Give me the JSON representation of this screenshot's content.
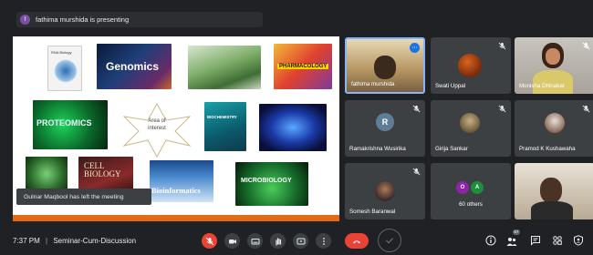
{
  "banner": {
    "avatar_letter": "f",
    "text": "fathima murshida is presenting"
  },
  "slide": {
    "labels": {
      "rna": "RNA Biology",
      "genomics": "Genomics",
      "pharmacology": "PHARMACOLOGY",
      "proteomics": "PROTEOMICS",
      "area": "Area of interest",
      "biochem": "BIOCHEMISTRY",
      "cell": "CELL BIOLOGY",
      "bioinformatics": "Bioinformatics",
      "microbiology": "MICROBIOLOGY"
    },
    "accent_color": "#e06a16"
  },
  "toast": "Gulnar Maqbool has left the meeting",
  "participants": [
    {
      "name": "fathima murshida",
      "type": "video"
    },
    {
      "name": "Swati Uppal",
      "type": "photo"
    },
    {
      "name": "Monisha Dhinakar",
      "type": "video"
    },
    {
      "name": "Ramakrishna Wusirika",
      "type": "avatar",
      "letter": "R"
    },
    {
      "name": "Girija Sankar",
      "type": "photo"
    },
    {
      "name": "Pramod K Kushawaha",
      "type": "photo"
    },
    {
      "name": "Somesh Baranwal",
      "type": "photo"
    },
    {
      "name": "60 others",
      "type": "others",
      "letters": [
        "O",
        "A"
      ]
    },
    {
      "name": "",
      "type": "video"
    }
  ],
  "bottom": {
    "time": "7:37 PM",
    "separator": "|",
    "meeting": "Seminar-Cum-Discussion",
    "people_count": "67",
    "controls": [
      "mic-off-icon",
      "camera-icon",
      "captions-icon",
      "raise-hand-icon",
      "present-icon",
      "more-icon",
      "end-call-icon"
    ],
    "end_call_color": "#ea4335"
  }
}
